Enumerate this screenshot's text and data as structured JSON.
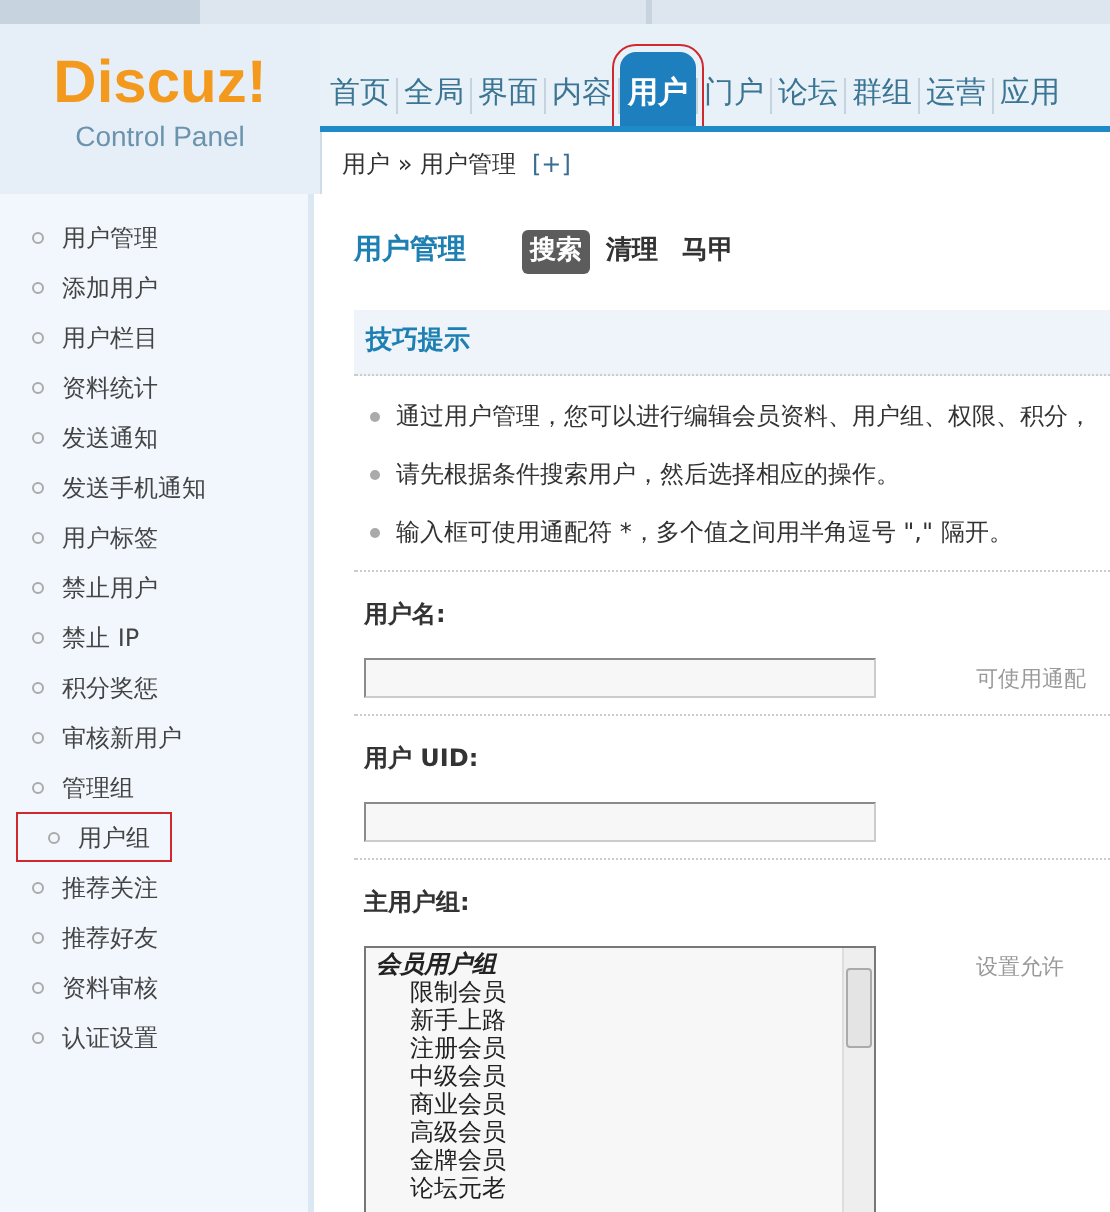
{
  "logo": {
    "title": "Discuz!",
    "subtitle": "Control Panel"
  },
  "nav": [
    {
      "label": "首页",
      "selected": false,
      "highlighted": false
    },
    {
      "label": "全局",
      "selected": false,
      "highlighted": false
    },
    {
      "label": "界面",
      "selected": false,
      "highlighted": false
    },
    {
      "label": "内容",
      "selected": false,
      "highlighted": false
    },
    {
      "label": "用户",
      "selected": true,
      "highlighted": true
    },
    {
      "label": "门户",
      "selected": false,
      "highlighted": false
    },
    {
      "label": "论坛",
      "selected": false,
      "highlighted": false
    },
    {
      "label": "群组",
      "selected": false,
      "highlighted": false
    },
    {
      "label": "运营",
      "selected": false,
      "highlighted": false
    },
    {
      "label": "应用",
      "selected": false,
      "highlighted": false
    }
  ],
  "breadcrumb": {
    "path": "用户 » 用户管理",
    "add": "[+]"
  },
  "sidebar": {
    "items": [
      {
        "label": "用户管理",
        "highlighted": false
      },
      {
        "label": "添加用户",
        "highlighted": false
      },
      {
        "label": "用户栏目",
        "highlighted": false
      },
      {
        "label": "资料统计",
        "highlighted": false
      },
      {
        "label": "发送通知",
        "highlighted": false
      },
      {
        "label": "发送手机通知",
        "highlighted": false
      },
      {
        "label": "用户标签",
        "highlighted": false
      },
      {
        "label": "禁止用户",
        "highlighted": false
      },
      {
        "label": "禁止 IP",
        "highlighted": false
      },
      {
        "label": "积分奖惩",
        "highlighted": false
      },
      {
        "label": "审核新用户",
        "highlighted": false
      },
      {
        "label": "管理组",
        "highlighted": false
      },
      {
        "label": "用户组",
        "highlighted": true
      },
      {
        "label": "推荐关注",
        "highlighted": false
      },
      {
        "label": "推荐好友",
        "highlighted": false
      },
      {
        "label": "资料审核",
        "highlighted": false
      },
      {
        "label": "认证设置",
        "highlighted": false
      }
    ]
  },
  "page": {
    "title": "用户管理",
    "tabs": [
      {
        "label": "搜索",
        "selected": true
      },
      {
        "label": "清理",
        "selected": false
      },
      {
        "label": "马甲",
        "selected": false
      }
    ]
  },
  "tips": {
    "title": "技巧提示",
    "items": [
      "通过用户管理，您可以进行编辑会员资料、用户组、权限、积分，",
      "请先根据条件搜索用户，然后选择相应的操作。",
      "输入框可使用通配符 *，多个值之间用半角逗号 \",\" 隔开。"
    ]
  },
  "form": [
    {
      "kind": "text",
      "label": "用户名:",
      "hint": "可使用通配"
    },
    {
      "kind": "text",
      "label": "用户 UID:"
    },
    {
      "kind": "list",
      "label": "主用户组:",
      "hint": "设置允许",
      "options": [
        {
          "label": "会员用户组",
          "kind": "group"
        },
        {
          "label": "限制会员",
          "kind": "option"
        },
        {
          "label": "新手上路",
          "kind": "option"
        },
        {
          "label": "注册会员",
          "kind": "option"
        },
        {
          "label": "中级会员",
          "kind": "option"
        },
        {
          "label": "商业会员",
          "kind": "option"
        },
        {
          "label": "高级会员",
          "kind": "option"
        },
        {
          "label": "金牌会员",
          "kind": "option"
        },
        {
          "label": "论坛元老",
          "kind": "option"
        }
      ]
    }
  ]
}
